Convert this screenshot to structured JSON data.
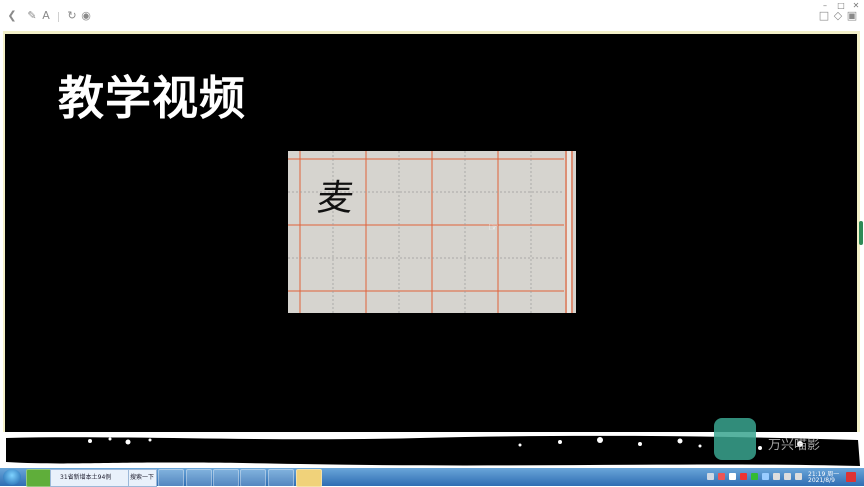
{
  "slide": {
    "title": "教学视频",
    "video_character": "麦"
  },
  "taskbar": {
    "ie_task_label": "31省新增本土94例",
    "search_label": "搜索一下",
    "clock_time": "21:19 周一",
    "clock_date": "2021/8/9"
  },
  "watermark": {
    "text": "万兴喵影"
  },
  "icons": [
    "back-icon",
    "edit-icon",
    "font-icon",
    "refresh-icon",
    "compass-icon",
    "share-icon",
    "cube-icon",
    "expand-icon"
  ],
  "colors": {
    "slide_bg": "#000000",
    "frame_bg": "#f3f0c8",
    "grid_red": "#e0623a",
    "taskbar": "#2f6db3"
  }
}
